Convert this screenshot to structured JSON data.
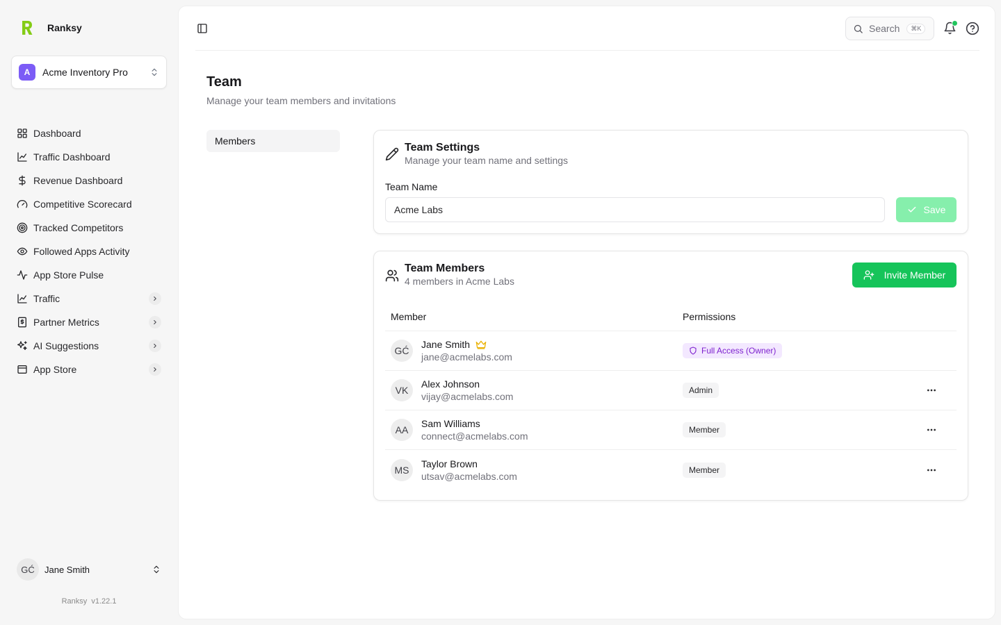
{
  "brand": {
    "name": "Ranksy",
    "accent": "#84cc16"
  },
  "org": {
    "initial": "A",
    "name": "Acme Inventory Pro"
  },
  "nav": [
    {
      "label": "Dashboard",
      "icon": "grid-icon",
      "chevron": false
    },
    {
      "label": "Traffic Dashboard",
      "icon": "chart-line-icon",
      "chevron": false
    },
    {
      "label": "Revenue Dashboard",
      "icon": "dollar-icon",
      "chevron": false
    },
    {
      "label": "Competitive Scorecard",
      "icon": "gauge-icon",
      "chevron": false
    },
    {
      "label": "Tracked Competitors",
      "icon": "target-icon",
      "chevron": false
    },
    {
      "label": "Followed Apps Activity",
      "icon": "eye-icon",
      "chevron": false
    },
    {
      "label": "App Store Pulse",
      "icon": "pulse-icon",
      "chevron": false
    },
    {
      "label": "Traffic",
      "icon": "chart-line-icon",
      "chevron": true
    },
    {
      "label": "Partner Metrics",
      "icon": "receipt-icon",
      "chevron": true
    },
    {
      "label": "AI Suggestions",
      "icon": "sparkles-icon",
      "chevron": true
    },
    {
      "label": "App Store",
      "icon": "browser-icon",
      "chevron": true
    }
  ],
  "user": {
    "initials": "GĆ",
    "name": "Jane Smith"
  },
  "version": "Ranksy  v1.22.1",
  "topbar": {
    "search_label": "Search",
    "search_shortcut": "⌘K"
  },
  "page": {
    "title": "Team",
    "subtitle": "Manage your team members and invitations",
    "subnav": "Members"
  },
  "settings": {
    "title": "Team Settings",
    "subtitle": "Manage your team name and settings",
    "field_label": "Team Name",
    "team_name": "Acme Labs",
    "save_label": "Save"
  },
  "members_card": {
    "title": "Team Members",
    "subtitle": "4 members in Acme Labs",
    "invite_label": "Invite Member",
    "col_member": "Member",
    "col_permissions": "Permissions",
    "rows": [
      {
        "initials": "GĆ",
        "name": "Jane Smith",
        "email": "jane@acmelabs.com",
        "permission": "Full Access (Owner)",
        "owner": true
      },
      {
        "initials": "VK",
        "name": "Alex Johnson",
        "email": "vijay@acmelabs.com",
        "permission": "Admin",
        "owner": false
      },
      {
        "initials": "AA",
        "name": "Sam Williams",
        "email": "connect@acmelabs.com",
        "permission": "Member",
        "owner": false
      },
      {
        "initials": "MS",
        "name": "Taylor Brown",
        "email": "utsav@acmelabs.com",
        "permission": "Member",
        "owner": false
      }
    ]
  }
}
